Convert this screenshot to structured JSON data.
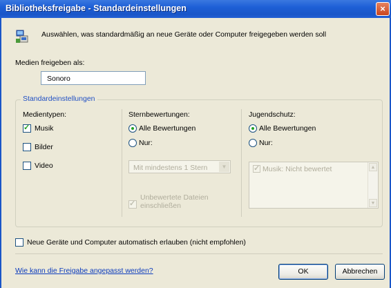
{
  "window": {
    "title": "Bibliotheksfreigabe - Standardeinstellungen",
    "close_glyph": "×"
  },
  "header": {
    "text": "Auswählen, was standardmäßig an neue Geräte oder Computer freigegeben werden soll",
    "icon": "shared-devices-icon"
  },
  "share_as": {
    "label": "Medien freigeben als:",
    "value": "Sonoro"
  },
  "defaults": {
    "legend": "Standardeinstellungen",
    "media_types": {
      "heading": "Medientypen:",
      "items": [
        {
          "label": "Musik",
          "checked": true
        },
        {
          "label": "Bilder",
          "checked": false
        },
        {
          "label": "Video",
          "checked": false
        }
      ]
    },
    "star_ratings": {
      "heading": "Sternbewertungen:",
      "all_label": "Alle Bewertungen",
      "only_label": "Nur:",
      "selected": "all",
      "select_value": "Mit mindestens 1 Stern",
      "include_unrated_line1": "Unbewertete Dateien",
      "include_unrated_line2": "einschließen"
    },
    "parental": {
      "heading": "Jugendschutz:",
      "all_label": "Alle Bewertungen",
      "only_label": "Nur:",
      "selected": "all",
      "list_items": [
        {
          "label": "Musik: Nicht bewertet",
          "checked": true
        }
      ]
    }
  },
  "auto_allow": {
    "label": "Neue Geräte und Computer automatisch erlauben (nicht empfohlen)",
    "checked": false
  },
  "footer": {
    "help_link": "Wie kann die Freigabe angepasst werden?",
    "ok_label": "OK",
    "cancel_label": "Abbrechen"
  }
}
